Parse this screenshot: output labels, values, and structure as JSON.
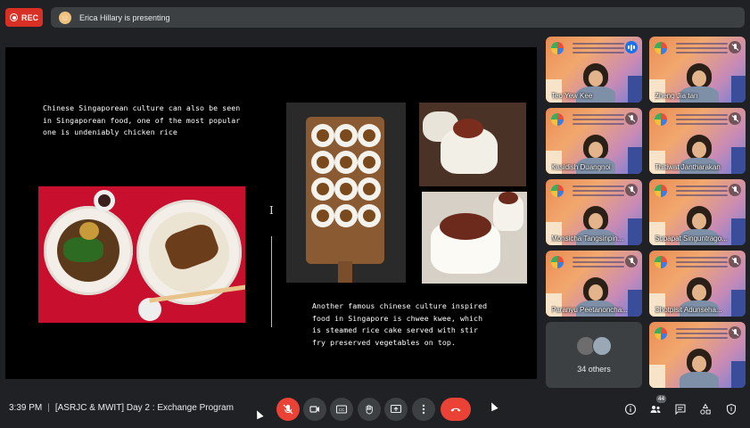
{
  "recording": {
    "label": "REC"
  },
  "presenter": {
    "text": "Erica Hillary is presenting"
  },
  "slide": {
    "paragraph_1": "Chinese Singaporean culture can also be seen in Singaporean food, one of the most popular one is undeniably chicken rice",
    "paragraph_2": "Another famous chinese culture inspired food in Singapore is chwee kwee, which is steamed rice cake served with stir fry preserved vegetables on top.",
    "cursor_glyph": "I"
  },
  "participants": [
    {
      "name": "Teo Yew Kee",
      "status": "speaking"
    },
    {
      "name": "Zheng Jia tan",
      "status": "muted"
    },
    {
      "name": "Kasidish Duangnoi",
      "status": "muted"
    },
    {
      "name": "Thitiwat Jantharakan",
      "status": "muted"
    },
    {
      "name": "Monsicha Tangsinpin...",
      "status": "muted"
    },
    {
      "name": "Supapat Singuntrago...",
      "status": "muted"
    },
    {
      "name": "Paranyu Peetanoncha...",
      "status": "muted"
    },
    {
      "name": "Chotpisit Adunseha...",
      "status": "muted"
    },
    {
      "name": "",
      "status": "muted"
    }
  ],
  "others_tile": {
    "label": "34 others"
  },
  "meeting": {
    "time": "3:39 PM",
    "separator": "|",
    "title": "[ASRJC & MWIT] Day 2 : Exchange Program"
  },
  "people_count": "44",
  "colors": {
    "rec": "#d93025",
    "end_call": "#ea4335",
    "mic_off": "#ea4335",
    "speaking": "#1a73e8"
  }
}
